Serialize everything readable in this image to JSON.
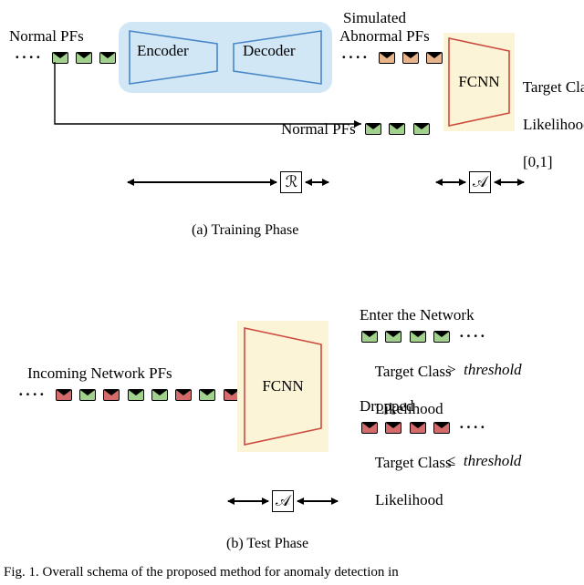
{
  "training": {
    "normal_pfs": "Normal PFs",
    "encoder": "Encoder",
    "decoder": "Decoder",
    "simulated1": "Simulated",
    "simulated2": "Abnormal PFs",
    "fcnn": "FCNN",
    "target1": "Target Class",
    "target2": "Likelihood",
    "target3": "[0,1]",
    "normal_out": "Normal PFs",
    "R": "ℛ",
    "A": "𝒜",
    "caption": "(a) Training Phase"
  },
  "testing": {
    "incoming": "Incoming Network PFs",
    "fcnn": "FCNN",
    "enter": "Enter the Network",
    "tclass": "Target Class",
    "likelihood": "Likelihood",
    "gt": "threshold",
    "dropped": "Dropped",
    "le": "threshold",
    "A": "𝒜",
    "caption": "(b) Test Phase"
  },
  "figure_caption": "Fig. 1.   Overall schema of the proposed method for anomaly detection in"
}
